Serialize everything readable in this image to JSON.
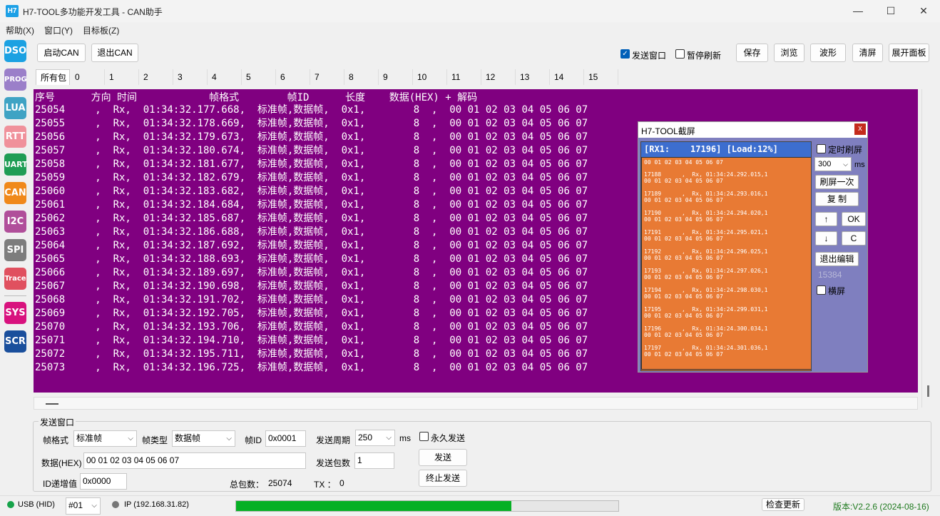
{
  "window": {
    "title": "H7-TOOL多功能开发工具 - CAN助手",
    "app_icon": "H7",
    "minimize_icon": "—",
    "maximize_icon": "☐",
    "close_icon": "✕"
  },
  "menu": [
    "帮助(X)",
    "窗口(Y)",
    "目标板(Z)"
  ],
  "sidebar": [
    {
      "label": "DSO",
      "color": "#1ba1e2"
    },
    {
      "label": "PROG",
      "color": "#9b7fc9"
    },
    {
      "label": "LUA",
      "color": "#3fa3c4"
    },
    {
      "label": "RTT",
      "color": "#f0919b"
    },
    {
      "label": "UART",
      "color": "#1f9d55"
    },
    {
      "label": "CAN",
      "color": "#f0891a"
    },
    {
      "label": "I2C",
      "color": "#b04f9a"
    },
    {
      "label": "SPI",
      "color": "#7d7d7d"
    },
    {
      "label": "Trace",
      "color": "#e0505f"
    },
    {
      "label": "SYS",
      "color": "#d8127e"
    },
    {
      "label": "SCR",
      "color": "#1a4f9c"
    }
  ],
  "toolbar": {
    "start_can": "启动CAN",
    "exit_can": "退出CAN",
    "send_window_label": "发送窗口",
    "send_window_checked": true,
    "pause_refresh_label": "暂停刷新",
    "pause_refresh_checked": false,
    "save": "保存",
    "browse": "浏览",
    "waveform": "波形",
    "clear": "清屏",
    "expand_panel": "展开面板"
  },
  "tabs": [
    "所有包",
    "0",
    "1",
    "2",
    "3",
    "4",
    "5",
    "6",
    "7",
    "8",
    "9",
    "10",
    "11",
    "12",
    "13",
    "14",
    "15"
  ],
  "log": {
    "header": "序号      方向 时间            帧格式        帧ID      长度    数据(HEX) + 解码",
    "rows": [
      "25054     ,  Rx,  01:34:32.177.668,  标准帧,数据帧,  0x1,        8  ,  00 01 02 03 04 05 06 07",
      "25055     ,  Rx,  01:34:32.178.669,  标准帧,数据帧,  0x1,        8  ,  00 01 02 03 04 05 06 07",
      "25056     ,  Rx,  01:34:32.179.673,  标准帧,数据帧,  0x1,        8  ,  00 01 02 03 04 05 06 07",
      "25057     ,  Rx,  01:34:32.180.674,  标准帧,数据帧,  0x1,        8  ,  00 01 02 03 04 05 06 07",
      "25058     ,  Rx,  01:34:32.181.677,  标准帧,数据帧,  0x1,        8  ,  00 01 02 03 04 05 06 07",
      "25059     ,  Rx,  01:34:32.182.679,  标准帧,数据帧,  0x1,        8  ,  00 01 02 03 04 05 06 07",
      "25060     ,  Rx,  01:34:32.183.682,  标准帧,数据帧,  0x1,        8  ,  00 01 02 03 04 05 06 07",
      "25061     ,  Rx,  01:34:32.184.684,  标准帧,数据帧,  0x1,        8  ,  00 01 02 03 04 05 06 07",
      "25062     ,  Rx,  01:34:32.185.687,  标准帧,数据帧,  0x1,        8  ,  00 01 02 03 04 05 06 07",
      "25063     ,  Rx,  01:34:32.186.688,  标准帧,数据帧,  0x1,        8  ,  00 01 02 03 04 05 06 07",
      "25064     ,  Rx,  01:34:32.187.692,  标准帧,数据帧,  0x1,        8  ,  00 01 02 03 04 05 06 07",
      "25065     ,  Rx,  01:34:32.188.693,  标准帧,数据帧,  0x1,        8  ,  00 01 02 03 04 05 06 07",
      "25066     ,  Rx,  01:34:32.189.697,  标准帧,数据帧,  0x1,        8  ,  00 01 02 03 04 05 06 07",
      "25067     ,  Rx,  01:34:32.190.698,  标准帧,数据帧,  0x1,        8  ,  00 01 02 03 04 05 06 07",
      "25068     ,  Rx,  01:34:32.191.702,  标准帧,数据帧,  0x1,        8  ,  00 01 02 03 04 05 06 07",
      "25069     ,  Rx,  01:34:32.192.705,  标准帧,数据帧,  0x1,        8  ,  00 01 02 03 04 05 06 07",
      "25070     ,  Rx,  01:34:32.193.706,  标准帧,数据帧,  0x1,        8  ,  00 01 02 03 04 05 06 07",
      "25071     ,  Rx,  01:34:32.194.710,  标准帧,数据帧,  0x1,        8  ,  00 01 02 03 04 05 06 07",
      "25072     ,  Rx,  01:34:32.195.711,  标准帧,数据帧,  0x1,        8  ,  00 01 02 03 04 05 06 07",
      "25073     ,  Rx,  01:34:32.196.725,  标准帧,数据帧,  0x1,        8  ,  00 01 02 03 04 05 06 07"
    ]
  },
  "popup": {
    "title": "H7-TOOL截屏",
    "close_icon": "x",
    "screen_header": "[RX1:    17196] [Load:12%]",
    "screen_lines": [
      "00 01 02 03 04 05 06 07",
      "17188      ,  Rx, 01:34:24.292.015,1",
      "00 01 02 03 04 05 06 07",
      "17189      ,  Rx, 01:34:24.293.016,1",
      "00 01 02 03 04 05 06 07",
      "17190      ,  Rx, 01:34:24.294.020,1",
      "00 01 02 03 04 05 06 07",
      "17191      ,  Rx, 01:34:24.295.021,1",
      "00 01 02 03 04 05 06 07",
      "17192      ,  Rx, 01:34:24.296.025,1",
      "00 01 02 03 04 05 06 07",
      "17193      ,  Rx, 01:34:24.297.026,1",
      "00 01 02 03 04 05 06 07",
      "17194      ,  Rx, 01:34:24.298.030,1",
      "00 01 02 03 04 05 06 07",
      "17195      ,  Rx, 01:34:24.299.031,1",
      "00 01 02 03 04 05 06 07",
      "17196      ,  Rx, 01:34:24.300.034,1",
      "00 01 02 03 04 05 06 07",
      "17197      ,  Rx, 01:34:24.301.036,1",
      "00 01 02 03 04 05 06 07"
    ],
    "timed_refresh": "定时刷屏",
    "interval": "300",
    "interval_unit": "ms",
    "refresh_once": "刷屏一次",
    "copy": "复 制",
    "up": "↑",
    "ok": "OK",
    "down": "↓",
    "c": "C",
    "exit_edit": "退出编辑",
    "counter": "15384",
    "landscape": "横屏"
  },
  "send": {
    "group_title": "发送窗口",
    "frame_format_label": "帧格式",
    "frame_format_value": "标准帧",
    "frame_type_label": "帧类型",
    "frame_type_value": "数据帧",
    "frame_id_label": "帧ID",
    "frame_id_value": "0x0001",
    "period_label": "发送周期",
    "period_value": "250",
    "period_unit": "ms",
    "forever_label": "永久发送",
    "data_label": "数据(HEX)",
    "data_value": "00 01 02 03 04 05 06 07",
    "count_label": "发送包数",
    "count_value": "1",
    "send_button": "发送",
    "stop_button": "终止发送",
    "id_inc_label": "ID递增值",
    "id_inc_value": "0x0000",
    "total_label": "总包数：",
    "total_value": "25074",
    "tx_label": "TX ：",
    "tx_value": "0"
  },
  "status": {
    "usb": "USB (HID)",
    "usb_color": "#16a34a",
    "device": "#01",
    "ip": "IP (192.168.31.82)",
    "ip_color": "#777777",
    "progress": 0.72,
    "check_update": "检查更新",
    "version": "版本:V2.2.6 (2024-08-16)"
  }
}
